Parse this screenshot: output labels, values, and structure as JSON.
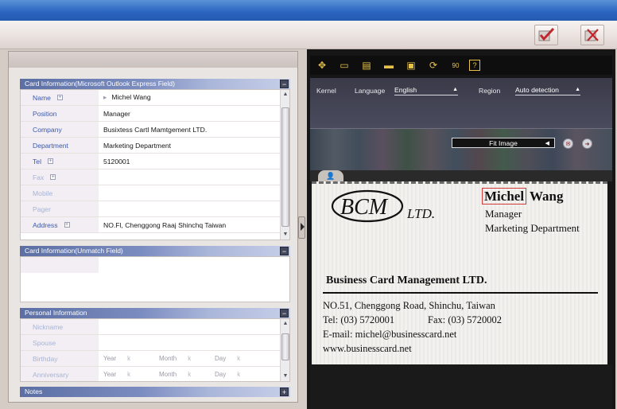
{
  "toolbar": {
    "ok_icon": "checkmark-icon",
    "cancel_icon": "close-x-icon",
    "ok_color": "#c0272d"
  },
  "card_info": {
    "title": "Card Information(Microsoft Outlook Express Field)",
    "fields": [
      {
        "label": "Name",
        "value": "Michel Wang",
        "expandable": true
      },
      {
        "label": "Position",
        "value": "Manager"
      },
      {
        "label": "Company",
        "value": "Busixtess Cartl Mamtgement LTD."
      },
      {
        "label": "Department",
        "value": "Marketing Department"
      },
      {
        "label": "Tel",
        "value": "5120001",
        "expandable": true
      },
      {
        "label": "Fax",
        "value": "",
        "expandable": true
      },
      {
        "label": "Mobile",
        "value": ""
      },
      {
        "label": "Pager",
        "value": ""
      },
      {
        "label": "Address",
        "value": "NO.Fl, Chenggong Raaj Shinchq Taiwan",
        "expandable": true
      }
    ]
  },
  "unmatch": {
    "title": "Card Information(Unmatch Field)"
  },
  "personal": {
    "title": "Personal Information",
    "fields": [
      {
        "label": "Nickname"
      },
      {
        "label": "Spouse"
      },
      {
        "label": "Birthday"
      },
      {
        "label": "Anniversary"
      }
    ],
    "date_parts": {
      "year": "Year",
      "month": "Month",
      "day": "Day",
      "sep": "k"
    }
  },
  "notes": {
    "title": "Notes"
  },
  "recognition": {
    "kernel_label": "Kernel",
    "language_label": "Language",
    "language_value": "English",
    "region_label": "Region",
    "region_value": "Auto detection",
    "fit_value": "Fit Image",
    "icon_bar": [
      "move-icon",
      "select-region-icon",
      "layout-icon",
      "flip-icon",
      "crop-icon",
      "rotate-icon",
      "rotate-90-icon",
      "help-icon"
    ],
    "icon_bar_glyphs": [
      "✥",
      "▭",
      "▤",
      "▬",
      "▣",
      "⟳",
      "90",
      "?"
    ],
    "accent_color": "#e6c24a"
  },
  "card": {
    "logo": "BCM",
    "logo_suffix": "LTD.",
    "name_first": "Michel",
    "name_last": "Wang",
    "position": "Manager",
    "department": "Marketing Department",
    "company": "Business Card Management  LTD.",
    "address": "NO.51, Chenggong Road, Shinchu, Taiwan",
    "tel": "Tel: (03) 5720001",
    "fax": "Fax: (03) 5720002",
    "email": "E-mail: michel@businesscard.net",
    "web": "www.businesscard.net"
  }
}
